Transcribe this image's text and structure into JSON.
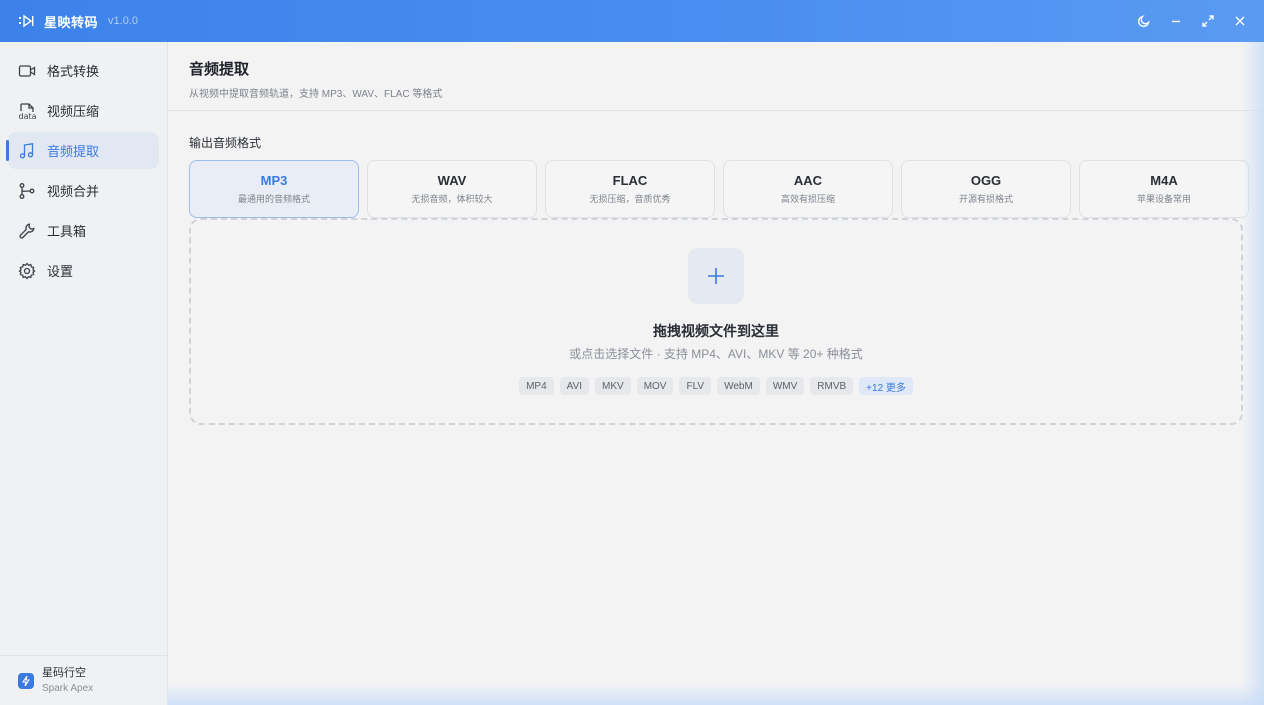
{
  "app": {
    "title": "星映转码",
    "version": "v1.0.0",
    "icon": "app-logo-icon"
  },
  "window_controls": [
    {
      "name": "theme-toggle-button",
      "icon": "moon-icon"
    },
    {
      "name": "minimize-button",
      "icon": "minimize-icon"
    },
    {
      "name": "maximize-button",
      "icon": "expand-icon"
    },
    {
      "name": "close-button",
      "icon": "close-icon"
    }
  ],
  "sidebar": {
    "items": [
      {
        "label": "格式转换",
        "icon": "video-camera-icon",
        "active": false
      },
      {
        "label": "视频压缩",
        "icon": "data-icon",
        "active": false
      },
      {
        "label": "音频提取",
        "icon": "music-note-icon",
        "active": true
      },
      {
        "label": "视频合并",
        "icon": "merge-icon",
        "active": false
      },
      {
        "label": "工具箱",
        "icon": "wrench-icon",
        "active": false
      },
      {
        "label": "设置",
        "icon": "gear-icon",
        "active": false
      }
    ],
    "footer": {
      "name": "星码行空",
      "sub": "Spark Apex",
      "icon": "lightning-icon"
    }
  },
  "page": {
    "title": "音频提取",
    "subtitle": "从视频中提取音频轨道，支持 MP3、WAV、FLAC 等格式"
  },
  "output": {
    "label": "输出音频格式",
    "formats": [
      {
        "name": "MP3",
        "desc": "最通用的音频格式",
        "selected": true
      },
      {
        "name": "WAV",
        "desc": "无损音频，体积较大",
        "selected": false
      },
      {
        "name": "FLAC",
        "desc": "无损压缩，音质优秀",
        "selected": false
      },
      {
        "name": "AAC",
        "desc": "高效有损压缩",
        "selected": false
      },
      {
        "name": "OGG",
        "desc": "开源有损格式",
        "selected": false
      },
      {
        "name": "M4A",
        "desc": "苹果设备常用",
        "selected": false
      }
    ]
  },
  "dropzone": {
    "title": "拖拽视频文件到这里",
    "hint": "或点击选择文件 · 支持 MP4、AVI、MKV 等 20+ 种格式",
    "chips": [
      "MP4",
      "AVI",
      "MKV",
      "MOV",
      "FLV",
      "WebM",
      "WMV",
      "RMVB"
    ],
    "more": "+12 更多",
    "icon": "plus-icon"
  },
  "colors": {
    "accent": "#3b7ae0",
    "titlebar": "#4a8ef0"
  }
}
